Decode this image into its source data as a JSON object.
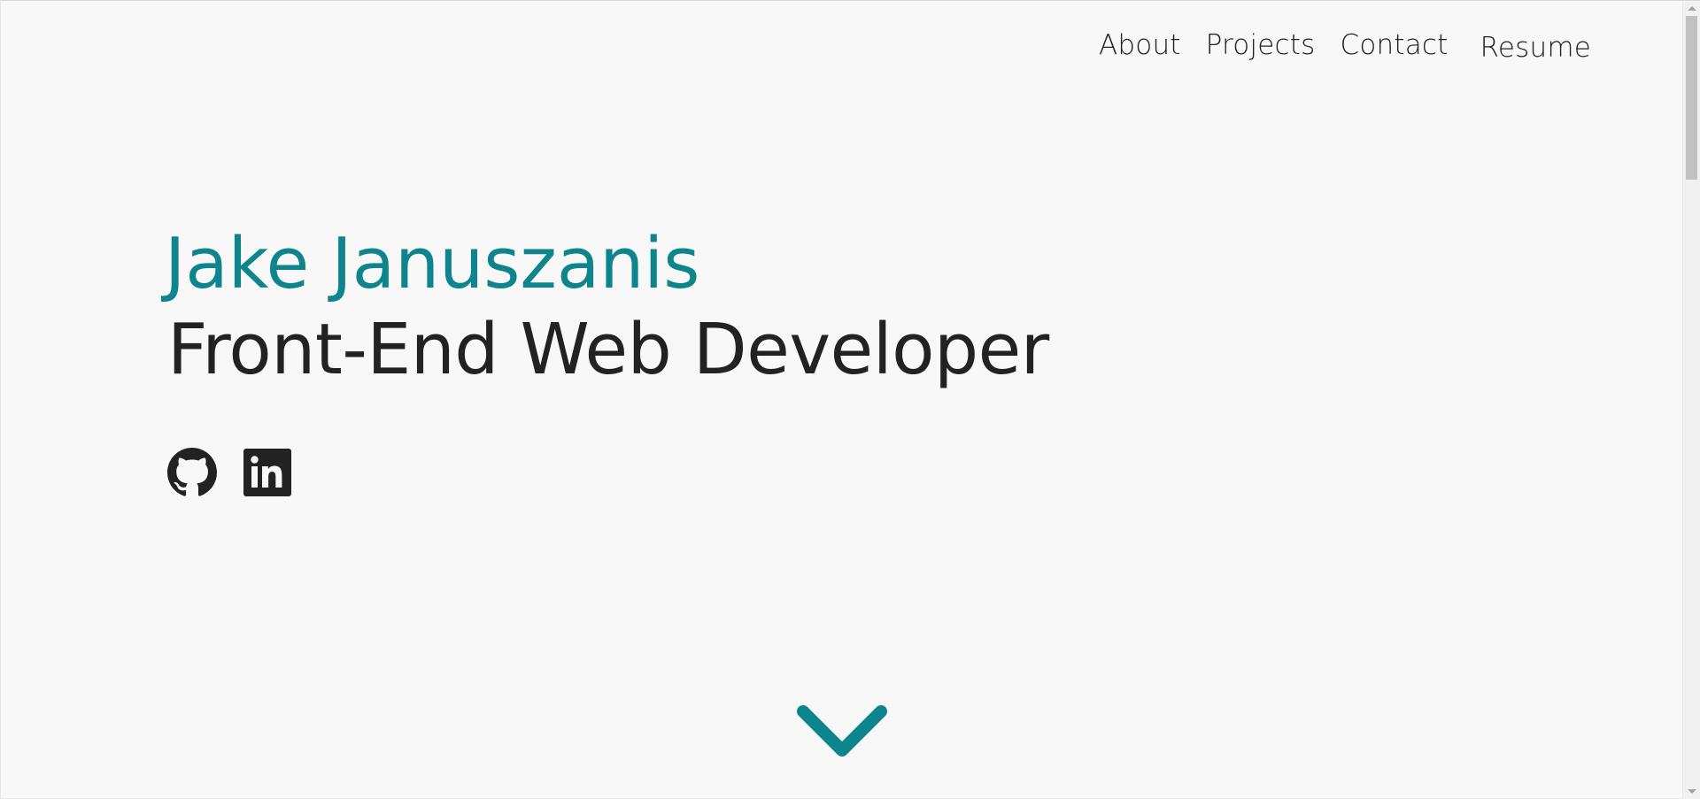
{
  "nav": {
    "items": [
      {
        "label": "About"
      },
      {
        "label": "Projects"
      },
      {
        "label": "Contact"
      },
      {
        "label": "Resume"
      }
    ]
  },
  "hero": {
    "name": "Jake Januszanis",
    "role": "Front-End Web Developer"
  },
  "socials": [
    {
      "icon": "github-icon"
    },
    {
      "icon": "linkedin-icon"
    }
  ],
  "scroll": {
    "icon": "chevron-down-icon"
  },
  "colors": {
    "accent": "#0e858c",
    "text": "#222222",
    "background": "#f8f8f9"
  }
}
